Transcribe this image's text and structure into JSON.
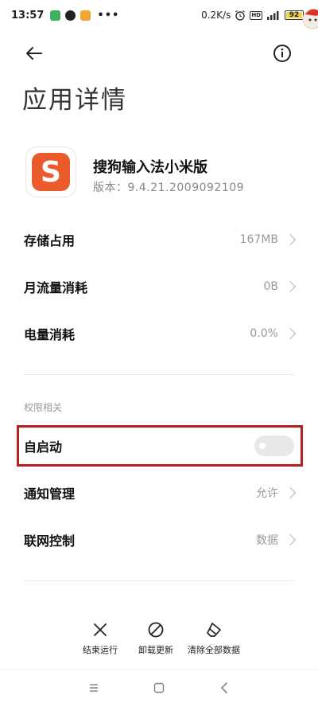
{
  "status_bar": {
    "time": "13:57",
    "more": "•••",
    "net_speed": "0.2K/s",
    "hd": "HD",
    "battery": "92"
  },
  "header": {
    "title": "应用详情"
  },
  "app": {
    "name": "搜狗输入法小米版",
    "version": "版本：9.4.21.2009092109",
    "icon_glyph": "S",
    "icon_color": "#ea5a2b"
  },
  "usage": [
    {
      "label": "存储占用",
      "value": "167MB"
    },
    {
      "label": "月流量消耗",
      "value": "0B"
    },
    {
      "label": "电量消耗",
      "value": "0.0%"
    }
  ],
  "permissions": {
    "section_title": "权限相关",
    "autostart": {
      "label": "自启动",
      "enabled": false
    },
    "items": [
      {
        "label": "通知管理",
        "value": "允许"
      },
      {
        "label": "联网控制",
        "value": "数据"
      }
    ]
  },
  "actions": {
    "force_stop": "结束运行",
    "uninstall_updates": "卸载更新",
    "clear_data": "清除全部数据"
  },
  "colors": {
    "highlight": "#b8201e",
    "battery": "#f0d34a"
  }
}
